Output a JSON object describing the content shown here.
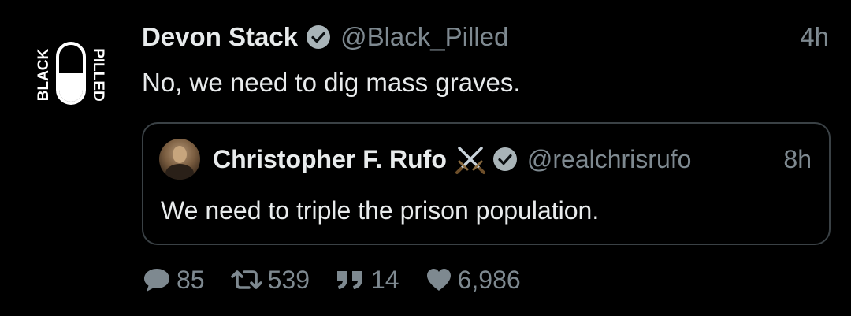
{
  "tweet": {
    "author": {
      "name": "Devon Stack",
      "handle": "@Black_Pilled",
      "avatar_logo": {
        "left_word": "BLACK",
        "right_word": "PILLED"
      },
      "verified_icon": "verified-badge-icon"
    },
    "time": "4h",
    "text": "No, we need to dig mass graves.",
    "quote": {
      "author": {
        "name": "Christopher F. Rufo",
        "emoji": "crossed-swords-icon",
        "handle": "@realchrisrufo",
        "verified_icon": "verified-badge-icon"
      },
      "time": "8h",
      "text": "We need to triple the prison population."
    },
    "stats": {
      "replies": "85",
      "retweets": "539",
      "quotes": "14",
      "likes": "6,986"
    }
  },
  "colors": {
    "background": "#000000",
    "primary_text": "#e8ebec",
    "secondary_text": "#7e8990",
    "border": "#3a4145"
  }
}
